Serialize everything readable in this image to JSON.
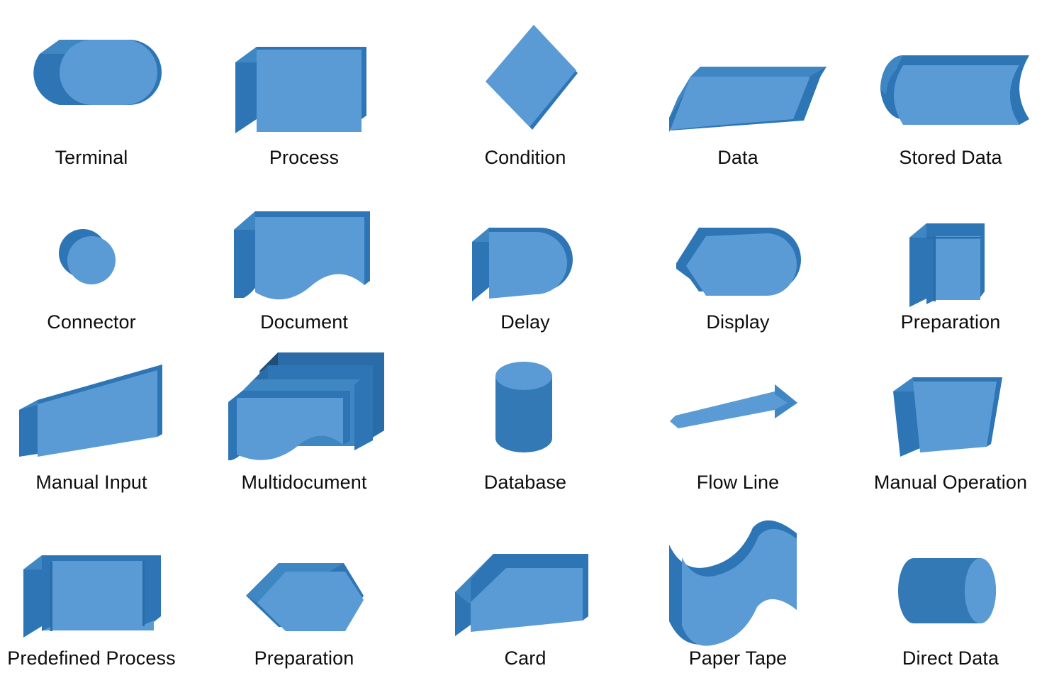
{
  "figure": {
    "kind": "flowchart-symbol-legend",
    "background_color": "#ffffff",
    "label_color": "#0d0d0d",
    "columns": 5,
    "rows": 4
  },
  "palette": {
    "face": "#5B9BD5",
    "face_light": "#6BA5DA",
    "side": "#2E75B6",
    "side_dark": "#2A6CA8",
    "top": "#3E87C3",
    "top_dark": "#1F4E79",
    "cylinder_body": "#3279B5",
    "cylinder_cap": "#5B9BD5"
  },
  "symbols": [
    {
      "id": "terminal",
      "label": "Terminal",
      "shape": "stadium",
      "row": 1,
      "col": 1
    },
    {
      "id": "process",
      "label": "Process",
      "shape": "rectangle",
      "row": 1,
      "col": 2
    },
    {
      "id": "condition",
      "label": "Condition",
      "shape": "diamond",
      "row": 1,
      "col": 3
    },
    {
      "id": "data",
      "label": "Data",
      "shape": "parallelogram",
      "row": 1,
      "col": 4
    },
    {
      "id": "stored-data",
      "label": "Stored Data",
      "shape": "stored-data",
      "row": 1,
      "col": 5
    },
    {
      "id": "connector",
      "label": "Connector",
      "shape": "circle",
      "row": 2,
      "col": 1
    },
    {
      "id": "document",
      "label": "Document",
      "shape": "document",
      "row": 2,
      "col": 2
    },
    {
      "id": "delay",
      "label": "Delay",
      "shape": "delay",
      "row": 2,
      "col": 3
    },
    {
      "id": "display",
      "label": "Display",
      "shape": "display",
      "row": 2,
      "col": 4
    },
    {
      "id": "preparation-box",
      "label": "Preparation",
      "shape": "barred-box-tall",
      "row": 2,
      "col": 5
    },
    {
      "id": "manual-input",
      "label": "Manual Input",
      "shape": "manual-input",
      "row": 3,
      "col": 1
    },
    {
      "id": "multidocument",
      "label": "Multidocument",
      "shape": "multidocument",
      "row": 3,
      "col": 2
    },
    {
      "id": "database",
      "label": "Database",
      "shape": "cylinder-vertical",
      "row": 3,
      "col": 3
    },
    {
      "id": "flow-line",
      "label": "Flow Line",
      "shape": "arrow",
      "row": 3,
      "col": 4
    },
    {
      "id": "manual-operation",
      "label": "Manual Operation",
      "shape": "trapezoid-inverted",
      "row": 3,
      "col": 5
    },
    {
      "id": "predefined-process",
      "label": "Predefined Process",
      "shape": "barred-box-wide",
      "row": 4,
      "col": 1
    },
    {
      "id": "preparation-hex",
      "label": "Preparation",
      "shape": "hexagon",
      "row": 4,
      "col": 2
    },
    {
      "id": "card",
      "label": "Card",
      "shape": "card",
      "row": 4,
      "col": 3
    },
    {
      "id": "paper-tape",
      "label": "Paper Tape",
      "shape": "paper-tape",
      "row": 4,
      "col": 4
    },
    {
      "id": "direct-data",
      "label": "Direct Data",
      "shape": "cylinder-horizontal",
      "row": 4,
      "col": 5
    }
  ]
}
